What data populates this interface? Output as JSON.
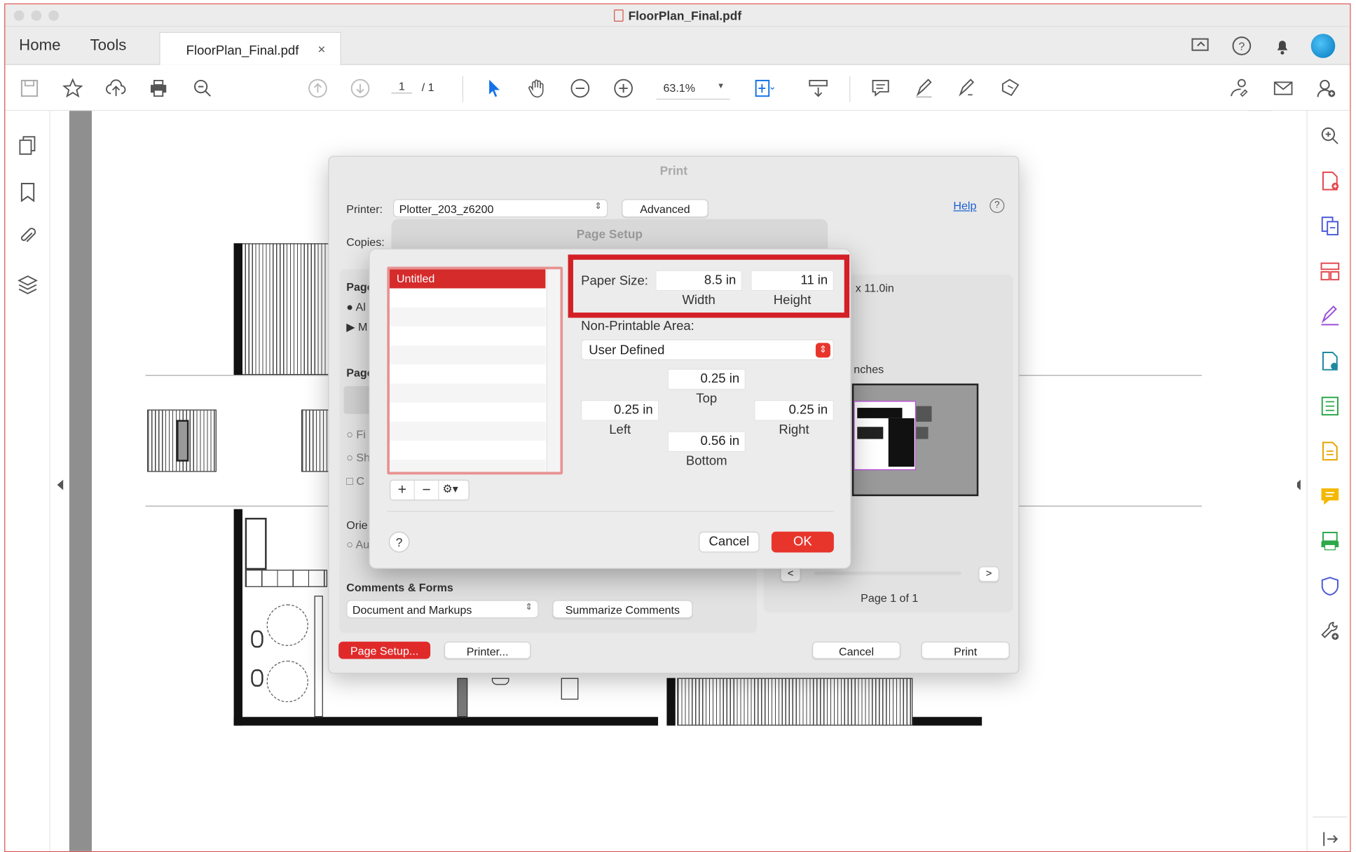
{
  "window": {
    "title": "FloorPlan_Final.pdf"
  },
  "nav": {
    "home": "Home",
    "tools": "Tools",
    "doc_tab": "FloorPlan_Final.pdf",
    "close": "×"
  },
  "toolbar": {
    "page_current": "1",
    "page_total": "/ 1",
    "zoom": "63.1%"
  },
  "print_dialog": {
    "title": "Print",
    "printer_label": "Printer:",
    "printer_value": "Plotter_203_z6200",
    "advanced": "Advanced",
    "help": "Help",
    "copies_label": "Copies:",
    "pages_label": "Page",
    "all_radio": "Al",
    "more": "M",
    "page_sizing_label": "Page",
    "fit": "Fi",
    "shrink": "Sh",
    "custom": "C",
    "orientation_label": "Orie",
    "auto": "Au",
    "size_text": "x 11.0in",
    "inches_text": "nches",
    "comments_title": "Comments & Forms",
    "comments_value": "Document and Markups",
    "summarize": "Summarize Comments",
    "page_of": "Page 1 of 1",
    "prev": "<",
    "next": ">",
    "page_setup_btn": "Page Setup...",
    "printer_btn": "Printer...",
    "cancel": "Cancel",
    "print": "Print"
  },
  "page_setup": {
    "title": "Page Setup",
    "list_item": "Untitled",
    "add": "+",
    "remove": "−",
    "paper_size_label": "Paper Size:",
    "width_value": "8.5 in",
    "height_value": "11 in",
    "width_label": "Width",
    "height_label": "Height",
    "nonprintable_label": "Non-Printable Area:",
    "nonprintable_value": "User Defined",
    "top_value": "0.25 in",
    "top_label": "Top",
    "left_value": "0.25 in",
    "left_label": "Left",
    "right_value": "0.25 in",
    "right_label": "Right",
    "bottom_value": "0.56 in",
    "bottom_label": "Bottom",
    "help_q": "?",
    "cancel": "Cancel",
    "ok": "OK"
  },
  "colors": {
    "accent_red": "#d31f26",
    "ok_red": "#e8352c",
    "list_select": "#d52b2b"
  }
}
